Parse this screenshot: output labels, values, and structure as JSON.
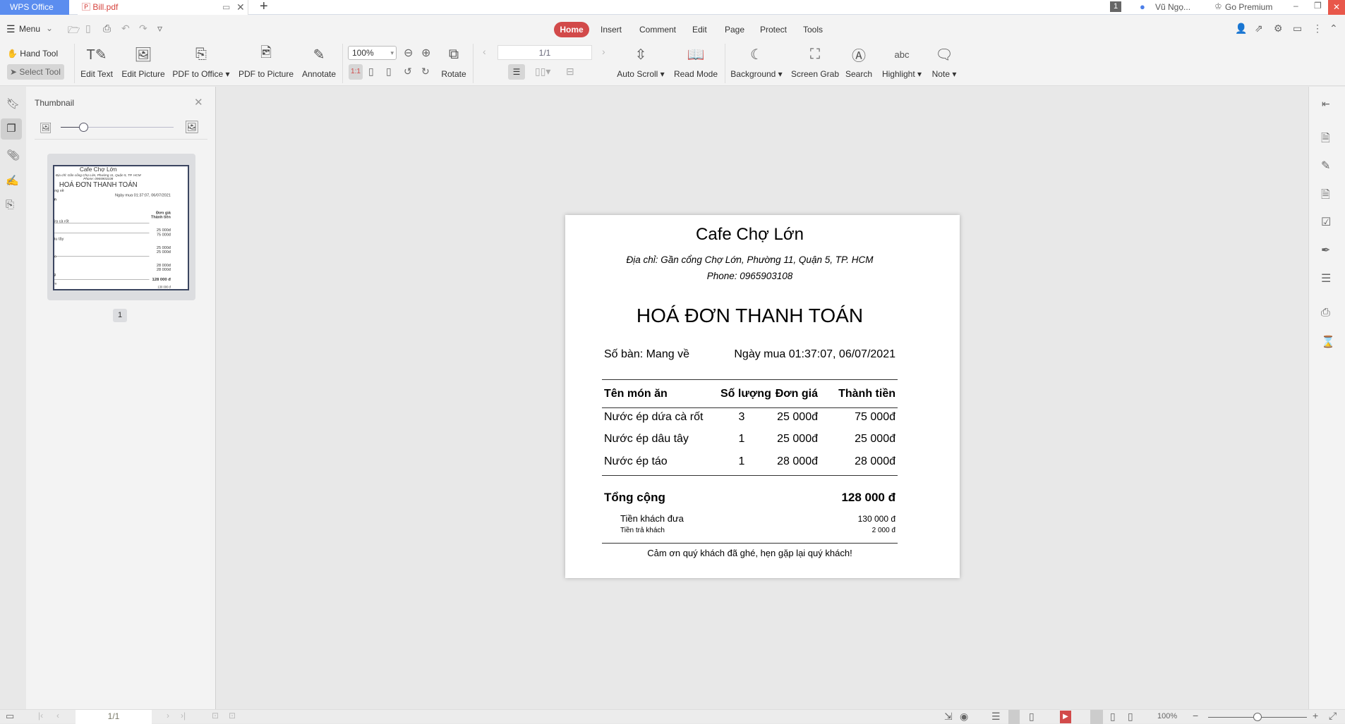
{
  "app": {
    "name": "WPS Office",
    "document_tab": "Bill.pdf",
    "window_badge": "1",
    "user": "Vũ Ngọ...",
    "premium": "Go Premium"
  },
  "menu": {
    "label": "Menu",
    "tabs": [
      "Home",
      "Insert",
      "Comment",
      "Edit",
      "Page",
      "Protect",
      "Tools"
    ],
    "active_tab": "Home"
  },
  "ribbon": {
    "hand_tool": "Hand Tool",
    "select_tool": "Select Tool",
    "items": [
      {
        "label": "Edit Text",
        "icon": "edit-text-icon"
      },
      {
        "label": "Edit Picture",
        "icon": "edit-picture-icon"
      },
      {
        "label": "PDF to Office",
        "icon": "pdf-to-office-icon"
      },
      {
        "label": "PDF to Picture",
        "icon": "pdf-to-picture-icon"
      },
      {
        "label": "Annotate",
        "icon": "annotate-icon"
      }
    ],
    "zoom": "100%",
    "rotate": "Rotate",
    "page_input": "1/1",
    "items2": [
      {
        "label": "Auto Scroll",
        "icon": "auto-scroll-icon"
      },
      {
        "label": "Read Mode",
        "icon": "read-mode-icon"
      },
      {
        "label": "Background",
        "icon": "moon-icon"
      },
      {
        "label": "Screen Grab",
        "icon": "screen-grab-icon"
      },
      {
        "label": "Search",
        "icon": "search-icon"
      },
      {
        "label": "Highlight",
        "icon": "highlight-icon"
      },
      {
        "label": "Note",
        "icon": "note-icon"
      }
    ]
  },
  "thumbnail": {
    "title": "Thumbnail",
    "page_number": "1",
    "size_slider": 0.2
  },
  "document": {
    "shop": "Cafe Chợ Lớn",
    "address": "Địa chỉ: Gần cổng Chợ Lớn, Phường 11, Quận 5, TP. HCM",
    "phone": "Phone: 0965903108",
    "heading": "HOÁ ĐƠN THANH TOÁN",
    "table_no": "Số bàn: Mang về",
    "date": "Ngày mua 01:37:07, 06/07/2021",
    "columns": [
      "Tên món ăn",
      "Số lượng",
      "Đơn giá",
      "Thành tiền"
    ],
    "rows": [
      [
        "Nước ép dứa cà rốt",
        "3",
        "25 000đ",
        "75 000đ"
      ],
      [
        "Nước ép dâu tây",
        "1",
        "25 000đ",
        "25 000đ"
      ],
      [
        "Nước ép táo",
        "1",
        "28 000đ",
        "28 000đ"
      ]
    ],
    "total_label": "Tổng cộng",
    "total": "128 000 đ",
    "paid_label": "Tiền khách đưa",
    "paid": "130 000 đ",
    "change_label": "Tiền trả khách",
    "change": "2 000 đ",
    "thanks": "Cảm ơn quý khách đã ghé, hẹn gặp lại quý khách!"
  },
  "status": {
    "page_input": "1/1",
    "zoom": "100%",
    "zoom_slider": 0.5
  },
  "colors": {
    "accent": "#d24a4a",
    "wps_blue": "#5b8def"
  }
}
